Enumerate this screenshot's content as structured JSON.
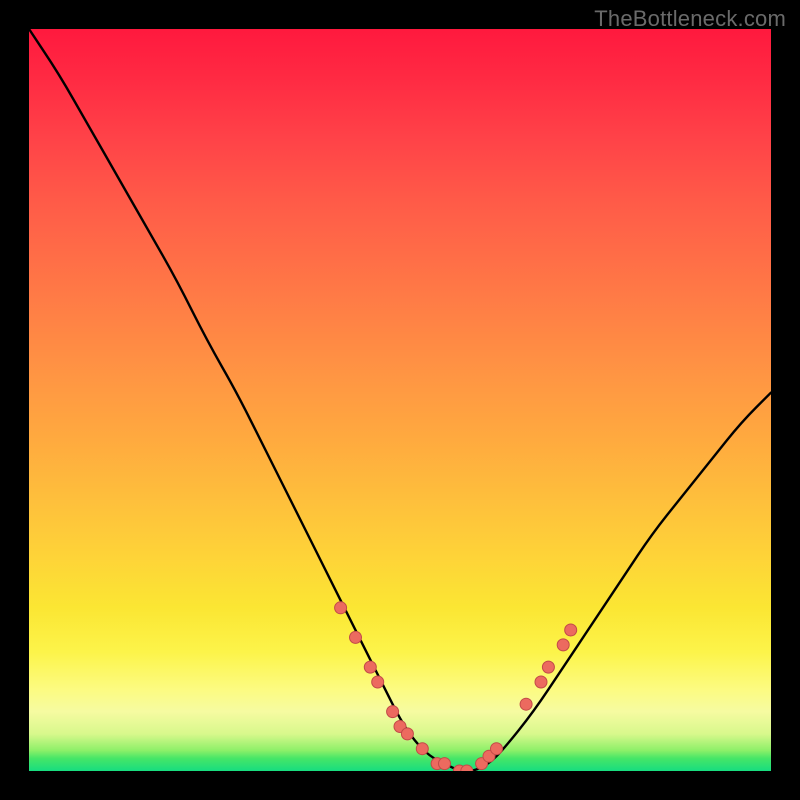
{
  "watermark": "TheBottleneck.com",
  "colors": {
    "frame": "#000000",
    "curve": "#000000",
    "marker_fill": "#ec6a5f",
    "marker_stroke": "#c24a48",
    "gradient_stops": [
      "#ff193e",
      "#ff6e47",
      "#febe3c",
      "#fcf44a",
      "#8ef069",
      "#17dd80"
    ]
  },
  "chart_data": {
    "type": "line",
    "title": "",
    "xlabel": "",
    "ylabel": "",
    "xlim": [
      0,
      100
    ],
    "ylim": [
      0,
      100
    ],
    "grid": false,
    "legend": false,
    "series": [
      {
        "name": "bottleneck-curve",
        "x": [
          0,
          4,
          8,
          12,
          16,
          20,
          24,
          28,
          32,
          36,
          40,
          44,
          48,
          50,
          52,
          54,
          56,
          58,
          60,
          62,
          64,
          68,
          72,
          76,
          80,
          84,
          88,
          92,
          96,
          100
        ],
        "values": [
          100,
          94,
          87,
          80,
          73,
          66,
          58,
          51,
          43,
          35,
          27,
          19,
          11,
          7,
          4,
          2,
          1,
          0,
          0,
          1,
          3,
          8,
          14,
          20,
          26,
          32,
          37,
          42,
          47,
          51
        ]
      }
    ],
    "markers": {
      "name": "highlighted-points",
      "points": [
        {
          "x": 42,
          "y": 22
        },
        {
          "x": 44,
          "y": 18
        },
        {
          "x": 46,
          "y": 14
        },
        {
          "x": 47,
          "y": 12
        },
        {
          "x": 49,
          "y": 8
        },
        {
          "x": 50,
          "y": 6
        },
        {
          "x": 51,
          "y": 5
        },
        {
          "x": 53,
          "y": 3
        },
        {
          "x": 55,
          "y": 1
        },
        {
          "x": 56,
          "y": 1
        },
        {
          "x": 58,
          "y": 0
        },
        {
          "x": 59,
          "y": 0
        },
        {
          "x": 61,
          "y": 1
        },
        {
          "x": 62,
          "y": 2
        },
        {
          "x": 63,
          "y": 3
        },
        {
          "x": 67,
          "y": 9
        },
        {
          "x": 69,
          "y": 12
        },
        {
          "x": 70,
          "y": 14
        },
        {
          "x": 72,
          "y": 17
        },
        {
          "x": 73,
          "y": 19
        }
      ]
    }
  }
}
